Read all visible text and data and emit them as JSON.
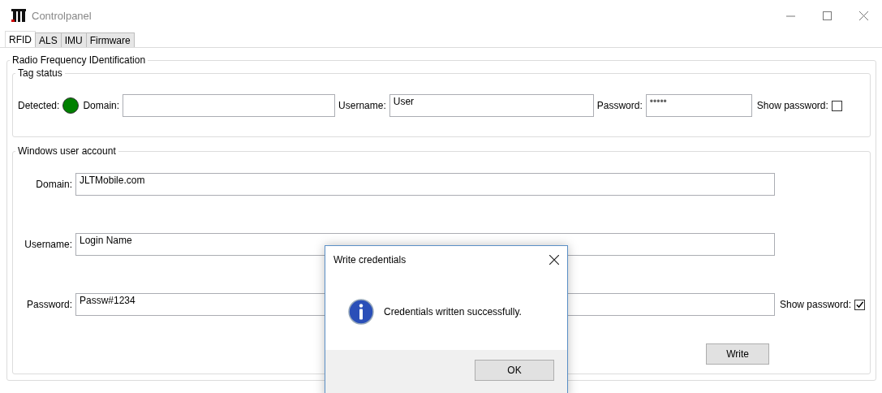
{
  "window": {
    "title": "Controlpanel"
  },
  "tabs": [
    {
      "label": "RFID",
      "selected": true
    },
    {
      "label": "ALS",
      "selected": false
    },
    {
      "label": "IMU",
      "selected": false
    },
    {
      "label": "Firmware",
      "selected": false
    }
  ],
  "group": {
    "title": "Radio Frequency IDentification"
  },
  "tag_status": {
    "title": "Tag status",
    "detected_label": "Detected:",
    "detected": true,
    "domain_label": "Domain:",
    "username_label": "Username:",
    "username": "User",
    "password_label": "Password:",
    "password": "•••••",
    "show_password_label": "Show password:",
    "show_password": false
  },
  "account": {
    "title": "Windows user account",
    "fields": [
      {
        "label": "Domain:",
        "value": "JLTMobile.com"
      },
      {
        "label": "Username:",
        "value": "Login Name"
      },
      {
        "label": "Password:",
        "value": "Passw#1234"
      }
    ],
    "show_password_label": "Show password:",
    "show_password": true,
    "write_button": "Write"
  },
  "dialog": {
    "title": "Write credentials",
    "message": "Credentials written successfully.",
    "button": "OK"
  }
}
